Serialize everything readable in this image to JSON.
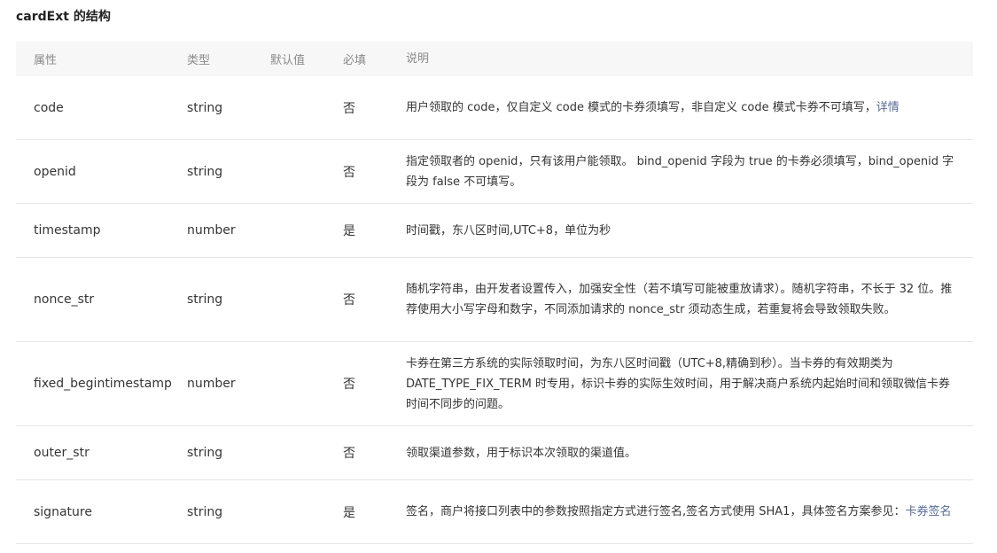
{
  "page": {
    "title": "cardExt 的结构"
  },
  "table": {
    "headers": {
      "attr": "属性",
      "type": "类型",
      "default": "默认值",
      "required": "必填",
      "desc": "说明"
    },
    "rows": [
      {
        "attr": "code",
        "type": "string",
        "default": "",
        "required": "否",
        "desc": "用户领取的 code，仅自定义 code 模式的卡券须填写，非自定义 code 模式卡券不可填写，",
        "link": "详情"
      },
      {
        "attr": "openid",
        "type": "string",
        "default": "",
        "required": "否",
        "desc": "指定领取者的 openid，只有该用户能领取。 bind_openid 字段为 true 的卡券必须填写，bind_openid 字段为 false 不可填写。",
        "link": ""
      },
      {
        "attr": "timestamp",
        "type": "number",
        "default": "",
        "required": "是",
        "desc": "时间戳，东八区时间,UTC+8，单位为秒",
        "link": ""
      },
      {
        "attr": "nonce_str",
        "type": "string",
        "default": "",
        "required": "否",
        "desc": "随机字符串，由开发者设置传入，加强安全性（若不填写可能被重放请求）。随机字符串，不长于 32 位。推荐使用大小写字母和数字，不同添加请求的 nonce_str 须动态生成，若重复将会导致领取失败。",
        "link": ""
      },
      {
        "attr": "fixed_begintimestamp",
        "type": "number",
        "default": "",
        "required": "否",
        "desc": "卡券在第三方系统的实际领取时间，为东八区时间戳（UTC+8,精确到秒）。当卡券的有效期类为 DATE_TYPE_FIX_TERM 时专用，标识卡券的实际生效时间，用于解决商户系统内起始时间和领取微信卡券时间不同步的问题。",
        "link": ""
      },
      {
        "attr": "outer_str",
        "type": "string",
        "default": "",
        "required": "否",
        "desc": "领取渠道参数，用于标识本次领取的渠道值。",
        "link": ""
      },
      {
        "attr": "signature",
        "type": "string",
        "default": "",
        "required": "是",
        "desc": "签名，商户将接口列表中的参数按照指定方式进行签名,签名方式使用 SHA1，具体签名方案参见：",
        "link": "卡券签名"
      }
    ]
  }
}
